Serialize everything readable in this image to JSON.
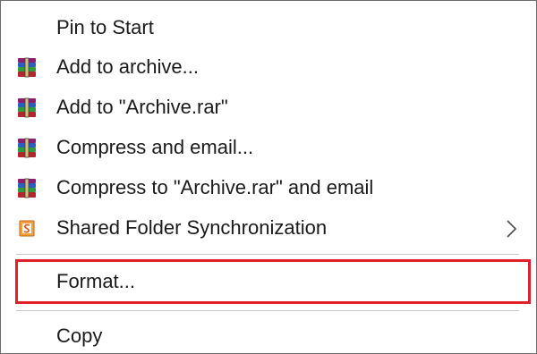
{
  "menu": {
    "items": [
      {
        "label": "Pin to Start",
        "icon": "none"
      },
      {
        "label": "Add to archive...",
        "icon": "winrar-icon"
      },
      {
        "label": "Add to \"Archive.rar\"",
        "icon": "winrar-icon"
      },
      {
        "label": "Compress and email...",
        "icon": "winrar-icon"
      },
      {
        "label": "Compress to \"Archive.rar\" and email",
        "icon": "winrar-icon"
      },
      {
        "label": "Shared Folder Synchronization",
        "icon": "shared-folder-sync-icon",
        "submenu": true
      },
      {
        "label": "Format...",
        "icon": "none",
        "highlighted": true
      },
      {
        "label": "Copy",
        "icon": "none"
      }
    ]
  },
  "colors": {
    "highlight_border": "#e0212b",
    "separator": "#c8c8c8",
    "text": "#1a1a1a"
  }
}
